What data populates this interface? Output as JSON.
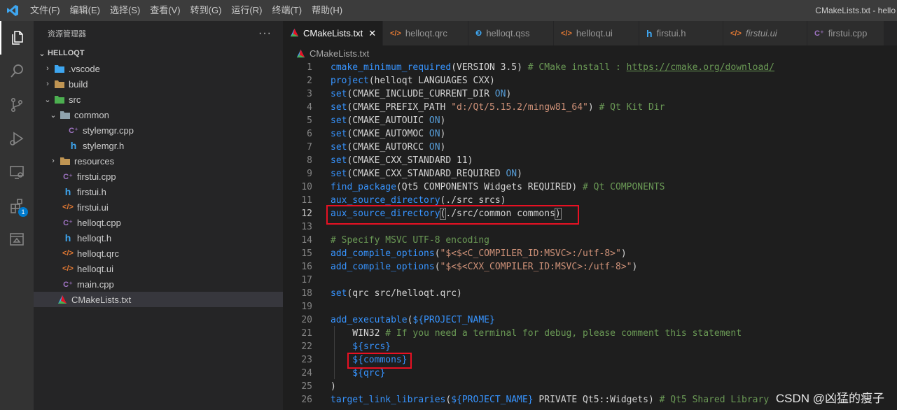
{
  "titlebar": {
    "menu": [
      "文件(F)",
      "编辑(E)",
      "选择(S)",
      "查看(V)",
      "转到(G)",
      "运行(R)",
      "终端(T)",
      "帮助(H)"
    ],
    "window_title": "CMakeLists.txt - hello"
  },
  "activitybar": {
    "extensions_badge": "1"
  },
  "sidebar": {
    "header": "资源管理器",
    "more": "···",
    "section": "HELLOQT",
    "items": [
      {
        "label": ".vscode",
        "icon": "vscode-folder-icon",
        "chevron": "›"
      },
      {
        "label": "build",
        "icon": "folder-icon",
        "chevron": "›"
      },
      {
        "label": "src",
        "icon": "src-folder-icon",
        "chevron": "⌄"
      },
      {
        "label": "common",
        "icon": "folder-icon",
        "chevron": "⌄"
      },
      {
        "label": "stylemgr.cpp",
        "icon": "cpp-file-icon"
      },
      {
        "label": "stylemgr.h",
        "icon": "h-file-icon"
      },
      {
        "label": "resources",
        "icon": "folder-icon",
        "chevron": "›"
      },
      {
        "label": "firstui.cpp",
        "icon": "cpp-file-icon"
      },
      {
        "label": "firstui.h",
        "icon": "h-file-icon"
      },
      {
        "label": "firstui.ui",
        "icon": "xml-file-icon"
      },
      {
        "label": "helloqt.cpp",
        "icon": "cpp-file-icon"
      },
      {
        "label": "helloqt.h",
        "icon": "h-file-icon"
      },
      {
        "label": "helloqt.qrc",
        "icon": "xml-file-icon"
      },
      {
        "label": "helloqt.ui",
        "icon": "xml-file-icon"
      },
      {
        "label": "main.cpp",
        "icon": "cpp-file-icon"
      },
      {
        "label": "CMakeLists.txt",
        "icon": "cmake-icon"
      }
    ]
  },
  "editor": {
    "tabs": [
      {
        "label": "CMakeLists.txt",
        "close": "✕"
      },
      {
        "label": "helloqt.qrc"
      },
      {
        "label": "helloqt.qss"
      },
      {
        "label": "helloqt.ui"
      },
      {
        "label": "firstui.h"
      },
      {
        "label": "firstui.ui"
      },
      {
        "label": "firstui.cpp"
      }
    ],
    "breadcrumb": "CMakeLists.txt",
    "line_numbers": [
      "1",
      "2",
      "3",
      "4",
      "5",
      "6",
      "7",
      "8",
      "9",
      "10",
      "11",
      "12",
      "13",
      "14",
      "15",
      "16",
      "17",
      "18",
      "19",
      "20",
      "21",
      "22",
      "23",
      "24",
      "25",
      "26"
    ],
    "code": {
      "l1_fn": "cmake_minimum_required",
      "l1_args": "(VERSION 3.5) ",
      "l1_cmt": "# CMake install : ",
      "l1_url": "https://cmake.org/download/",
      "l2_fn": "project",
      "l2_args": "(helloqt LANGUAGES CXX)",
      "l3_fn": "set",
      "l3_a": "(",
      "l3_var": "CMAKE_INCLUDE_CURRENT_DIR",
      "l3_val": " ON",
      "l3_b": ")",
      "l4_fn": "set",
      "l4_a": "(",
      "l4_var": "CMAKE_PREFIX_PATH",
      "l4_str": " \"d:/Qt/5.15.2/mingw81_64\"",
      "l4_b": ") ",
      "l4_cmt": "# Qt Kit Dir",
      "l5_fn": "set",
      "l5_a": "(CMAKE_AUTOUIC",
      "l5_val": " ON",
      "l5_b": ")",
      "l6_fn": "set",
      "l6_a": "(",
      "l6_var": "CMAKE_AUTOMOC",
      "l6_val": " ON",
      "l6_b": ")",
      "l7_fn": "set",
      "l7_a": "(",
      "l7_var": "CMAKE_AUTORCC",
      "l7_val": " ON",
      "l7_b": ")",
      "l8_fn": "set",
      "l8_a": "(CMAKE_CXX_STANDARD 11)",
      "l9_fn": "set",
      "l9_a": "(CMAKE_CXX_STANDARD_REQUIRED",
      "l9_val": " ON",
      "l9_b": ")",
      "l10_fn": "find_package",
      "l10_a": "(Qt5 COMPONENTS Widgets REQUIRED) ",
      "l10_cmt": "# Qt COMPONENTS",
      "l11_fn": "aux_source_directory",
      "l11_a": "(./src srcs)",
      "l12_fn": "aux_source_directory",
      "l12_p1": "(",
      "l12_a": "./src/common commons",
      "l12_p2": ")",
      "l14_cmt": "# Specify MSVC UTF-8 encoding",
      "l15_fn": "add_compile_options",
      "l15_a": "(",
      "l15_str": "\"$<$<C_COMPILER_ID:MSVC>:/utf-8>\"",
      "l15_b": ")",
      "l16_fn": "add_compile_options",
      "l16_a": "(",
      "l16_str": "\"$<$<CXX_COMPILER_ID:MSVC>:/utf-8>\"",
      "l16_b": ")",
      "l18_fn": "set",
      "l18_a": "(qrc src/helloqt.qrc)",
      "l20_fn": "add_executable",
      "l20_a": "(",
      "l20_var": "${PROJECT_NAME}",
      "l21_a": "    WIN32 ",
      "l21_cmt": "# If you need a terminal for debug, please comment this statement",
      "l22_var": "    ${srcs}",
      "l23_var": "    ${commons}",
      "l24_var": "    ${qrc}",
      "l25_a": ")",
      "l26_fn": "target_link_libraries",
      "l26_a": "(",
      "l26_var": "${PROJECT_NAME}",
      "l26_b": " PRIVATE Qt5::Widgets) ",
      "l26_cmt": "# Qt5 Shared Library"
    }
  },
  "watermark": "CSDN @凶猛的瘦子",
  "colors": {
    "highlight_box": "#e81123",
    "accent": "#007acc"
  }
}
